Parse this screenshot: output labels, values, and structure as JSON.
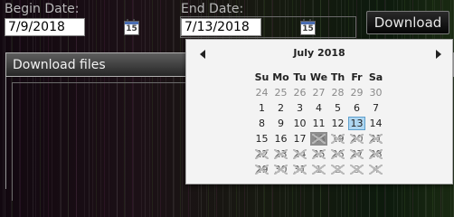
{
  "form": {
    "begin_label": "Begin Date:",
    "begin_value": "7/9/2018",
    "end_label": "End Date:",
    "end_value": "7/13/2018",
    "calendar_icon_day": "15",
    "download_label": "Download"
  },
  "panel": {
    "title": "Download files"
  },
  "datepicker": {
    "month_title": "July 2018",
    "weekdays": [
      "Su",
      "Mo",
      "Tu",
      "We",
      "Th",
      "Fr",
      "Sa"
    ],
    "selected_day": "13",
    "weeks": [
      [
        {
          "d": "24",
          "s": "other"
        },
        {
          "d": "25",
          "s": "other"
        },
        {
          "d": "26",
          "s": "other"
        },
        {
          "d": "27",
          "s": "other"
        },
        {
          "d": "28",
          "s": "other"
        },
        {
          "d": "29",
          "s": "other"
        },
        {
          "d": "30",
          "s": "other"
        }
      ],
      [
        {
          "d": "1",
          "s": "normal"
        },
        {
          "d": "2",
          "s": "normal"
        },
        {
          "d": "3",
          "s": "normal"
        },
        {
          "d": "4",
          "s": "normal"
        },
        {
          "d": "5",
          "s": "normal"
        },
        {
          "d": "6",
          "s": "normal"
        },
        {
          "d": "7",
          "s": "normal"
        }
      ],
      [
        {
          "d": "8",
          "s": "normal"
        },
        {
          "d": "9",
          "s": "normal"
        },
        {
          "d": "10",
          "s": "normal"
        },
        {
          "d": "11",
          "s": "normal"
        },
        {
          "d": "12",
          "s": "normal"
        },
        {
          "d": "13",
          "s": "selected"
        },
        {
          "d": "14",
          "s": "normal"
        }
      ],
      [
        {
          "d": "15",
          "s": "normal"
        },
        {
          "d": "16",
          "s": "normal"
        },
        {
          "d": "17",
          "s": "normal"
        },
        {
          "d": "18",
          "s": "disabled-first"
        },
        {
          "d": "19",
          "s": "disabled"
        },
        {
          "d": "20",
          "s": "disabled"
        },
        {
          "d": "21",
          "s": "disabled"
        }
      ],
      [
        {
          "d": "22",
          "s": "disabled"
        },
        {
          "d": "23",
          "s": "disabled"
        },
        {
          "d": "24",
          "s": "disabled"
        },
        {
          "d": "25",
          "s": "disabled"
        },
        {
          "d": "26",
          "s": "disabled"
        },
        {
          "d": "27",
          "s": "disabled"
        },
        {
          "d": "28",
          "s": "disabled"
        }
      ],
      [
        {
          "d": "29",
          "s": "disabled"
        },
        {
          "d": "30",
          "s": "disabled"
        },
        {
          "d": "31",
          "s": "disabled"
        },
        {
          "d": "1",
          "s": "disabled other"
        },
        {
          "d": "2",
          "s": "disabled other"
        },
        {
          "d": "3",
          "s": "disabled other"
        },
        {
          "d": "4",
          "s": "disabled other"
        }
      ]
    ]
  },
  "colors": {
    "selected_day_bg": "#aed6f1",
    "selected_day_border": "#5e9fcc",
    "disabled_first_bg": "#8c8c8c",
    "calendar_icon_top": "#4a6db3"
  }
}
